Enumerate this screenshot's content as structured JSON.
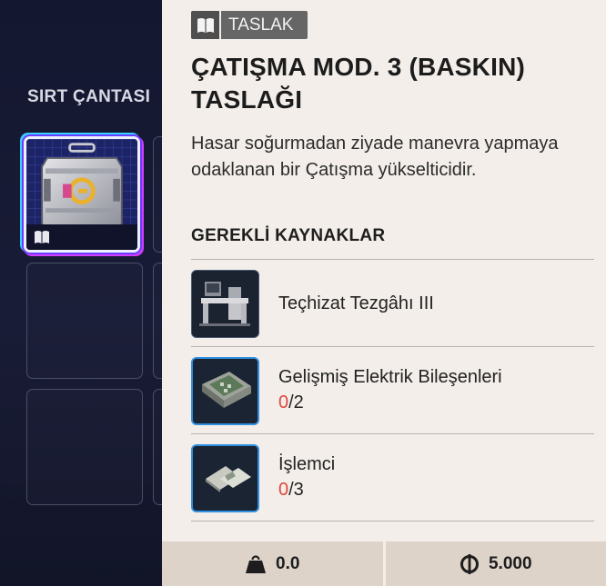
{
  "backpack": {
    "title": "SIRT ÇANTASI"
  },
  "item": {
    "badge": {
      "icon": "book-icon",
      "label": "TASLAK"
    },
    "title": "ÇATIŞMA MOD. 3 (BASKIN) TASLAĞI",
    "description": "Hasar soğurmadan ziyade manevra yapmaya odaklanan bir Çatışma yükselticidir."
  },
  "requirements": {
    "header": "GEREKLİ KAYNAKLAR",
    "items": [
      {
        "name": "Teçhizat Tezgâhı III",
        "icon": "workbench-icon"
      },
      {
        "name": "Gelişmiş Elektrik Bileşenleri",
        "have": "0",
        "need": "/2",
        "icon": "electrical-components-icon"
      },
      {
        "name": "İşlemci",
        "have": "0",
        "need": "/3",
        "icon": "processor-icon"
      }
    ]
  },
  "footer": {
    "weight": {
      "icon": "weight-icon",
      "value": "0.0"
    },
    "price": {
      "icon": "currency-icon",
      "value": "5.000"
    }
  },
  "colors": {
    "accent_missing": "#e0463c",
    "panel_bg": "#f3eee9",
    "dark_bg": "#11142a",
    "slot_glow_cyan": "#38d0ff",
    "slot_glow_purple": "#d23cff"
  }
}
